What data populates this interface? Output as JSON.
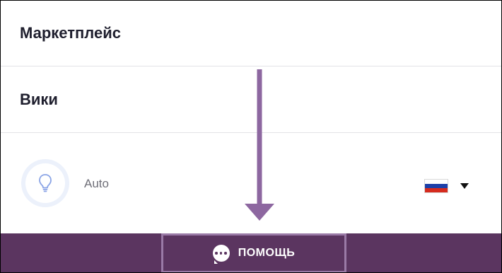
{
  "menu": {
    "items": [
      {
        "label": "Маркетплейс"
      },
      {
        "label": "Вики"
      }
    ]
  },
  "theme": {
    "icon": "lightbulb-icon",
    "label": "Auto"
  },
  "language": {
    "flag": "russia-flag-icon",
    "flag_colors": [
      "#ffffff",
      "#1c3fa8",
      "#d52b1e"
    ]
  },
  "help": {
    "label": "ПОМОЩЬ",
    "icon": "chat-bubble-icon"
  },
  "colors": {
    "footer": "#5b3560",
    "highlight": "#9a7aa6"
  }
}
